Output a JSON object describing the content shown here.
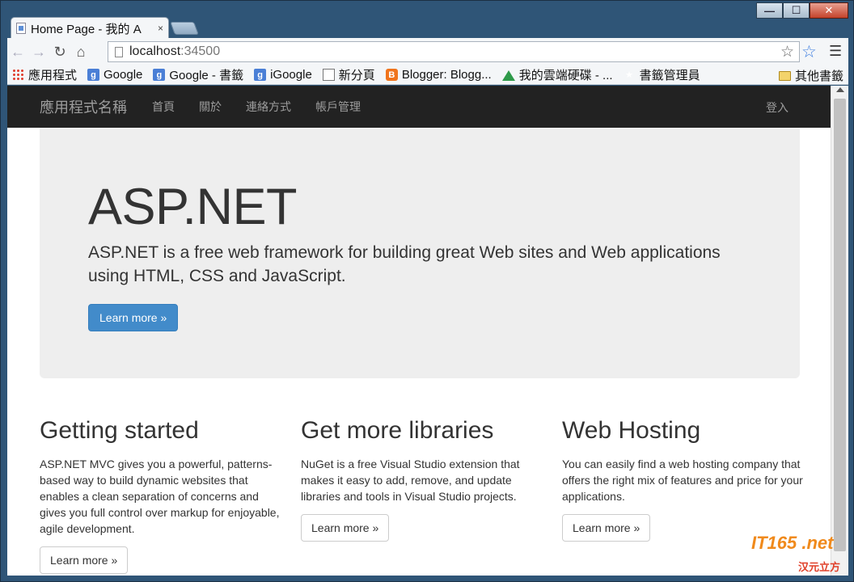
{
  "browser": {
    "tab_title": "Home Page - 我的 A",
    "tab_close": "×",
    "url_host": "localhost",
    "url_port": ":34500",
    "caption": {
      "minimize": "—",
      "maximize": "☐",
      "close": "✕"
    }
  },
  "bookmarks": [
    {
      "label": "應用程式",
      "icon": "apps-icon"
    },
    {
      "label": "Google",
      "icon": "google-icon"
    },
    {
      "label": "Google - 書籤",
      "icon": "google-icon"
    },
    {
      "label": "iGoogle",
      "icon": "google-icon"
    },
    {
      "label": "新分頁",
      "icon": "page-icon"
    },
    {
      "label": "Blogger: Blogg...",
      "icon": "blogger-icon"
    },
    {
      "label": "我的雲端硬碟 - ...",
      "icon": "drive-icon"
    },
    {
      "label": "書籤管理員",
      "icon": "star-icon"
    }
  ],
  "other_bookmarks": "其他書籤",
  "navbar": {
    "brand": "應用程式名稱",
    "links": [
      "首頁",
      "關於",
      "連絡方式",
      "帳戶管理"
    ],
    "login": "登入"
  },
  "jumbotron": {
    "title": "ASP.NET",
    "lead": "ASP.NET is a free web framework for building great Web sites and Web applications using HTML, CSS and JavaScript.",
    "button": "Learn more »"
  },
  "columns": [
    {
      "heading": "Getting started",
      "text": "ASP.NET MVC gives you a powerful, patterns-based way to build dynamic websites that enables a clean separation of concerns and gives you full control over markup for enjoyable, agile development.",
      "button": "Learn more »"
    },
    {
      "heading": "Get more libraries",
      "text": "NuGet is a free Visual Studio extension that makes it easy to add, remove, and update libraries and tools in Visual Studio projects.",
      "button": "Learn more »"
    },
    {
      "heading": "Web Hosting",
      "text": "You can easily find a web hosting company that offers the right mix of features and price for your applications.",
      "button": "Learn more »"
    }
  ],
  "watermark": {
    "logo": "IT165 .net",
    "sub": "汉元立方"
  },
  "colors": {
    "navbar": "#222222",
    "primary": "#428bca",
    "jumbotron": "#eeeeee"
  }
}
